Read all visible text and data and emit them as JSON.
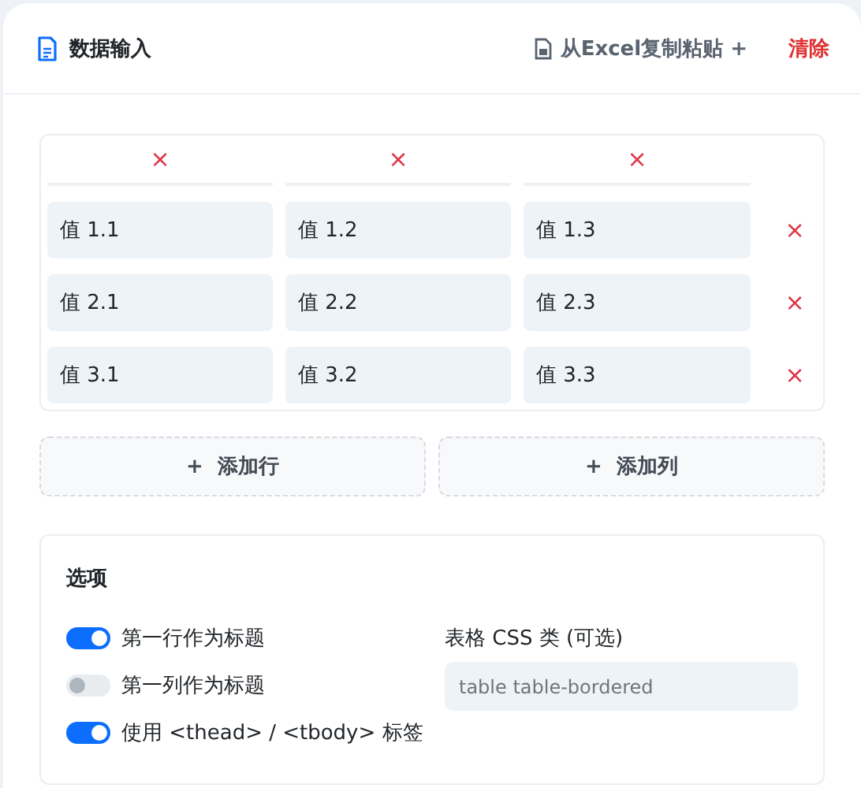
{
  "header": {
    "title": "数据输入",
    "paste_button": "从Excel复制粘贴 +",
    "clear_button": "清除"
  },
  "table": {
    "column_delete": [
      "×",
      "×",
      "×"
    ],
    "rows": [
      {
        "cells": [
          "值 1.1",
          "值 1.2",
          "值 1.3"
        ],
        "delete": "×"
      },
      {
        "cells": [
          "值 2.1",
          "值 2.2",
          "值 2.3"
        ],
        "delete": "×"
      },
      {
        "cells": [
          "值 3.1",
          "值 3.2",
          "值 3.3"
        ],
        "delete": "×"
      }
    ]
  },
  "add_buttons": [
    "+  添加行",
    "+  添加列"
  ],
  "options": {
    "title": "选项",
    "toggles": [
      {
        "label": "第一行作为标题",
        "on": true
      },
      {
        "label": "第一列作为标题",
        "on": false
      },
      {
        "label": "使用 <thead> / <tbody> 标签",
        "on": true
      }
    ],
    "css_class": {
      "label": "表格 CSS 类 (可选)",
      "placeholder": "table table-bordered"
    }
  }
}
